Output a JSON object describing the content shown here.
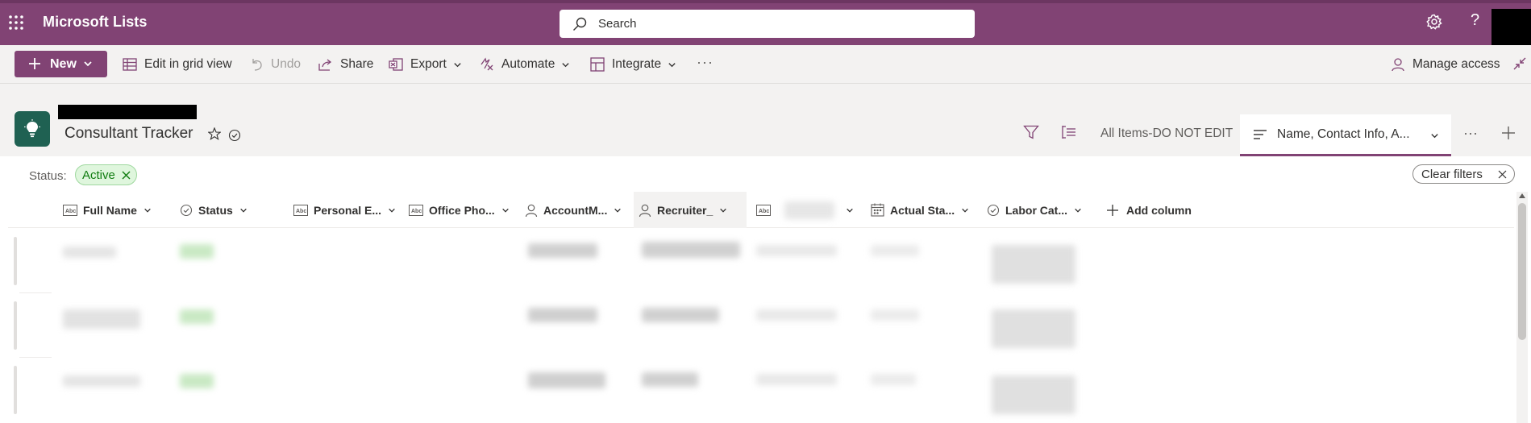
{
  "app": {
    "name": "Microsoft Lists",
    "search_placeholder": "Search",
    "help_label": "?"
  },
  "commands": {
    "new": "New",
    "edit_grid": "Edit in grid view",
    "undo": "Undo",
    "share": "Share",
    "export": "Export",
    "automate": "Automate",
    "integrate": "Integrate",
    "more": "···",
    "manage_access": "Manage access"
  },
  "list": {
    "title": "Consultant Tracker"
  },
  "views": {
    "all_items": "All Items-DO NOT EDIT",
    "active_view": "Name, Contact Info, A...",
    "more": "···"
  },
  "filters": {
    "label": "Status:",
    "active_value": "Active",
    "clear": "Clear filters"
  },
  "columns": [
    {
      "label": "Full Name",
      "type": "text-icon"
    },
    {
      "label": "Status",
      "type": "choice-icon"
    },
    {
      "label": "Personal E...",
      "type": "text-icon"
    },
    {
      "label": "Office Pho...",
      "type": "text-icon"
    },
    {
      "label": "AccountM...",
      "type": "person-icon"
    },
    {
      "label": "Recruiter_",
      "type": "person-icon"
    },
    {
      "label": "",
      "type": "text-icon"
    },
    {
      "label": "Actual Sta...",
      "type": "calendar-icon"
    },
    {
      "label": "Labor Cat...",
      "type": "choice-icon"
    }
  ],
  "add_column": "Add column",
  "colors": {
    "brand": "#814374",
    "brand_dark": "#6c3661",
    "list_icon": "#1f6152",
    "status_green": "#107c10",
    "status_green_bg": "#dff6dd"
  }
}
